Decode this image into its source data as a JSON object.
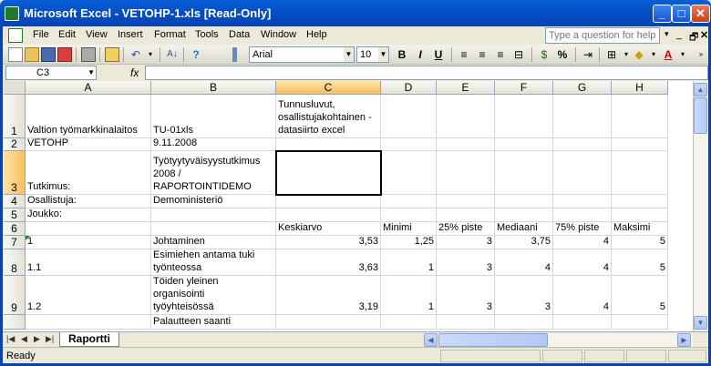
{
  "window": {
    "title": "Microsoft Excel - VETOHP-1.xls  [Read-Only]"
  },
  "menu": {
    "items": [
      "File",
      "Edit",
      "View",
      "Insert",
      "Format",
      "Tools",
      "Data",
      "Window",
      "Help"
    ],
    "help_placeholder": "Type a question for help"
  },
  "toolbar": {
    "font": "Arial",
    "size": "10",
    "bold": "B",
    "italic": "I",
    "underline": "U",
    "percent": "%"
  },
  "formula_bar": {
    "name_box": "C3",
    "fx": "fx",
    "content": ""
  },
  "grid": {
    "columns": [
      "A",
      "B",
      "C",
      "D",
      "E",
      "F",
      "G",
      "H"
    ],
    "selected_column": "C",
    "selected_row": "3",
    "rows": [
      {
        "num": "1",
        "cells": [
          "Valtion työmarkkinalaitos",
          "TU-01xls",
          "Tunnusluvut,\nosallistujakohtainen -\ndatasiirto excel",
          "",
          "",
          "",
          "",
          ""
        ]
      },
      {
        "num": "2",
        "cells": [
          "VETOHP",
          "9.11.2008",
          "",
          "",
          "",
          "",
          "",
          ""
        ]
      },
      {
        "num": "3",
        "cells": [
          "Tutkimus:",
          "Työtyytyväisyystutkimus\n2008 /\nRAPORTOINTIDEMO",
          "",
          "",
          "",
          "",
          "",
          ""
        ]
      },
      {
        "num": "4",
        "cells": [
          "Osallistuja:",
          "Demoministeriö",
          "",
          "",
          "",
          "",
          "",
          ""
        ]
      },
      {
        "num": "5",
        "cells": [
          "Joukko:",
          "",
          "",
          "",
          "",
          "",
          "",
          ""
        ]
      },
      {
        "num": "6",
        "cells": [
          "",
          "",
          "Keskiarvo",
          "Minimi",
          "25% piste",
          "Mediaani",
          "75% piste",
          "Maksimi"
        ]
      },
      {
        "num": "7",
        "cells": [
          "1",
          "Johtaminen",
          "3,53",
          "1,25",
          "3",
          "3,75",
          "4",
          "5"
        ]
      },
      {
        "num": "8",
        "cells": [
          "1.1",
          "Esimiehen antama tuki\ntyönteossa",
          "3,63",
          "1",
          "3",
          "4",
          "4",
          "5"
        ]
      },
      {
        "num": "9",
        "cells": [
          "1.2",
          "Töiden yleinen\norganisointi\ntyöyhteisössä",
          "3,19",
          "1",
          "3",
          "3",
          "4",
          "5"
        ]
      },
      {
        "num": "",
        "cells": [
          "",
          "Palautteen saanti",
          "",
          "",
          "",
          "",
          "",
          ""
        ]
      }
    ]
  },
  "sheet_tab": "Raportti",
  "status": {
    "text": "Ready"
  }
}
